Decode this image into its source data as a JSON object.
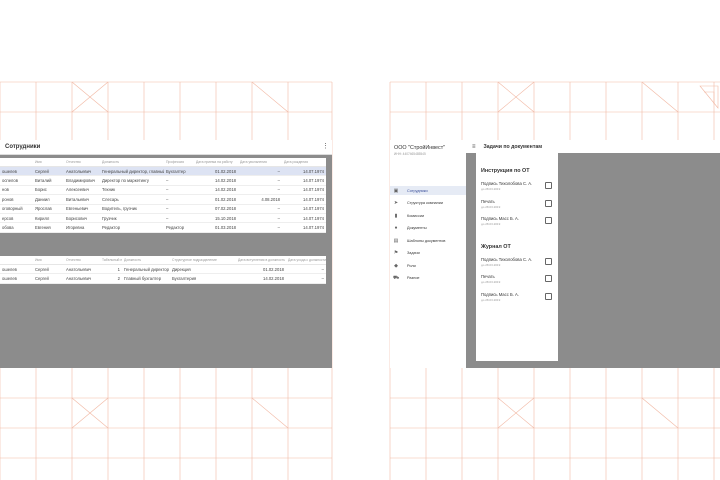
{
  "left": {
    "title": "Сотрудники",
    "menu_icon": "more-vert-icon",
    "table1": {
      "headers": [
        "",
        "Имя",
        "Отчество",
        "Должность",
        "Профессия",
        "Дата приема на работу",
        "Дата увольнения",
        "Дата рождения"
      ],
      "rows": [
        {
          "c": [
            "ошелев",
            "Сергей",
            "Анатольевич",
            "Генеральный директор, главный бухгалтер",
            "Бухгалтер",
            "01.02.2018",
            "–",
            "14.07.1974"
          ],
          "sel": true
        },
        {
          "c": [
            "оспелов",
            "Виталий",
            "Владимирович",
            "Директор по маркетингу",
            "–",
            "14.02.2018",
            "–",
            "14.07.1974"
          ],
          "sel": false
        },
        {
          "c": [
            "нов",
            "Борис",
            "Алексеевич",
            "Техник",
            "–",
            "14.02.2018",
            "–",
            "14.07.1974"
          ],
          "sel": false
        },
        {
          "c": [
            "ронов",
            "Даниил",
            "Витальевич",
            "Слесарь",
            "–",
            "01.02.2018",
            "4.08.2018",
            "14.07.1974"
          ],
          "sel": false
        },
        {
          "c": [
            "оговорный",
            "Ярослав",
            "Евгеньевич",
            "Водитель, грузчик",
            "–",
            "07.02.2018",
            "–",
            "14.07.1974"
          ],
          "sel": false
        },
        {
          "c": [
            "ерсов",
            "Кирилл",
            "Борисович",
            "Грузчик",
            "–",
            "15.10.2018",
            "–",
            "14.07.1974"
          ],
          "sel": false
        },
        {
          "c": [
            "обова",
            "Евгения",
            "Игоревна",
            "Редактор",
            "Редактор",
            "01.03.2018",
            "–",
            "14.07.1974"
          ],
          "sel": false
        }
      ]
    },
    "table2": {
      "headers": [
        "",
        "Имя",
        "Отчество",
        "Табельный номер",
        "Должность",
        "Структурное подразделение",
        "Дата вступления в должность",
        "Дата ухода с должности"
      ],
      "rows": [
        {
          "c": [
            "ошелев",
            "Сергей",
            "Анатольевич",
            "1",
            "Генеральный директор",
            "Дирекция",
            "01.02.2018",
            "–"
          ]
        },
        {
          "c": [
            "ошелев",
            "Сергей",
            "Анатольевич",
            "2",
            "Главный бухгалтер",
            "Бухгалтерия",
            "14.02.2018",
            "–"
          ]
        }
      ]
    }
  },
  "right": {
    "org": "ООО \"СтройИнвест\"",
    "org_sub": "ИНН: 4407465485545",
    "topbar_title": "Задачи по документам",
    "nav": [
      {
        "label": "Сотрудники",
        "icon": "people-icon",
        "active": true
      },
      {
        "label": "Структура компании",
        "icon": "send-icon",
        "active": false
      },
      {
        "label": "Комиссии",
        "icon": "trash-icon",
        "active": false
      },
      {
        "label": "Документы",
        "icon": "info-icon",
        "active": false
      },
      {
        "label": "Шаблоны документов",
        "icon": "chat-icon",
        "active": false
      },
      {
        "label": "Задачи",
        "icon": "flag-icon",
        "active": false
      },
      {
        "label": "Роли",
        "icon": "tag-icon",
        "active": false
      },
      {
        "label": "Разное",
        "icon": "cart-icon",
        "active": false
      }
    ],
    "sections": [
      {
        "title": "Инструкция по ОТ",
        "tasks": [
          {
            "label": "Подпись Тихолобова С. А.",
            "date": "до 28.03.2019"
          },
          {
            "label": "Печать",
            "date": "до 28.03.2019"
          },
          {
            "label": "Подпись Масс Б. А.",
            "date": "до 28.03.2019"
          }
        ]
      },
      {
        "title": "Журнал ОТ",
        "tasks": [
          {
            "label": "Подпись Тихолобова С. А.",
            "date": "до 28.03.2019"
          },
          {
            "label": "Печать",
            "date": "до 28.03.2019"
          },
          {
            "label": "Подпись Масс Б. А.",
            "date": "до 28.03.2019"
          }
        ]
      }
    ]
  },
  "colors": {
    "grid": "#f2b9a5",
    "overlay": "#8c8c8c",
    "selected": "#dde3f3",
    "accent": "#3b4f9a"
  }
}
